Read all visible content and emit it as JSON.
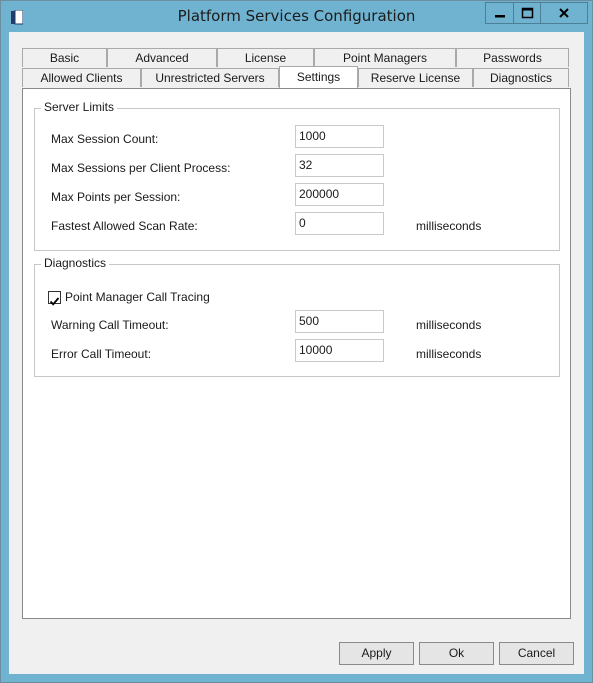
{
  "window": {
    "title": "Platform Services Configuration",
    "icon": "book-icon",
    "controls": [
      "minimize-icon",
      "maximize-icon",
      "close-icon"
    ]
  },
  "tabs": {
    "row_top": [
      "Basic",
      "Advanced",
      "License",
      "Point Managers",
      "Passwords"
    ],
    "row_bottom": [
      "Allowed Clients",
      "Unrestricted Servers",
      "Settings",
      "Reserve License",
      "Diagnostics"
    ],
    "active": "Settings"
  },
  "server_limits": {
    "title": "Server Limits",
    "rows": [
      {
        "label": "Max Session Count:",
        "value": "1000",
        "unit": ""
      },
      {
        "label": "Max Sessions per Client Process:",
        "value": "32",
        "unit": ""
      },
      {
        "label": "Max Points per Session:",
        "value": "200000",
        "unit": ""
      },
      {
        "label": "Fastest Allowed Scan Rate:",
        "value": "0",
        "unit": "milliseconds"
      }
    ]
  },
  "diagnostics": {
    "title": "Diagnostics",
    "tracing": {
      "label": "Point Manager Call Tracing",
      "checked": true
    },
    "rows": [
      {
        "label": "Warning Call Timeout:",
        "value": "500",
        "unit": "milliseconds"
      },
      {
        "label": "Error Call Timeout:",
        "value": "10000",
        "unit": "milliseconds"
      }
    ]
  },
  "buttons": {
    "apply": "Apply",
    "ok": "Ok",
    "cancel": "Cancel"
  },
  "colors": {
    "titlebar": "#6fb3d1",
    "client": "#f0f0f0",
    "panel": "#ffffff"
  }
}
